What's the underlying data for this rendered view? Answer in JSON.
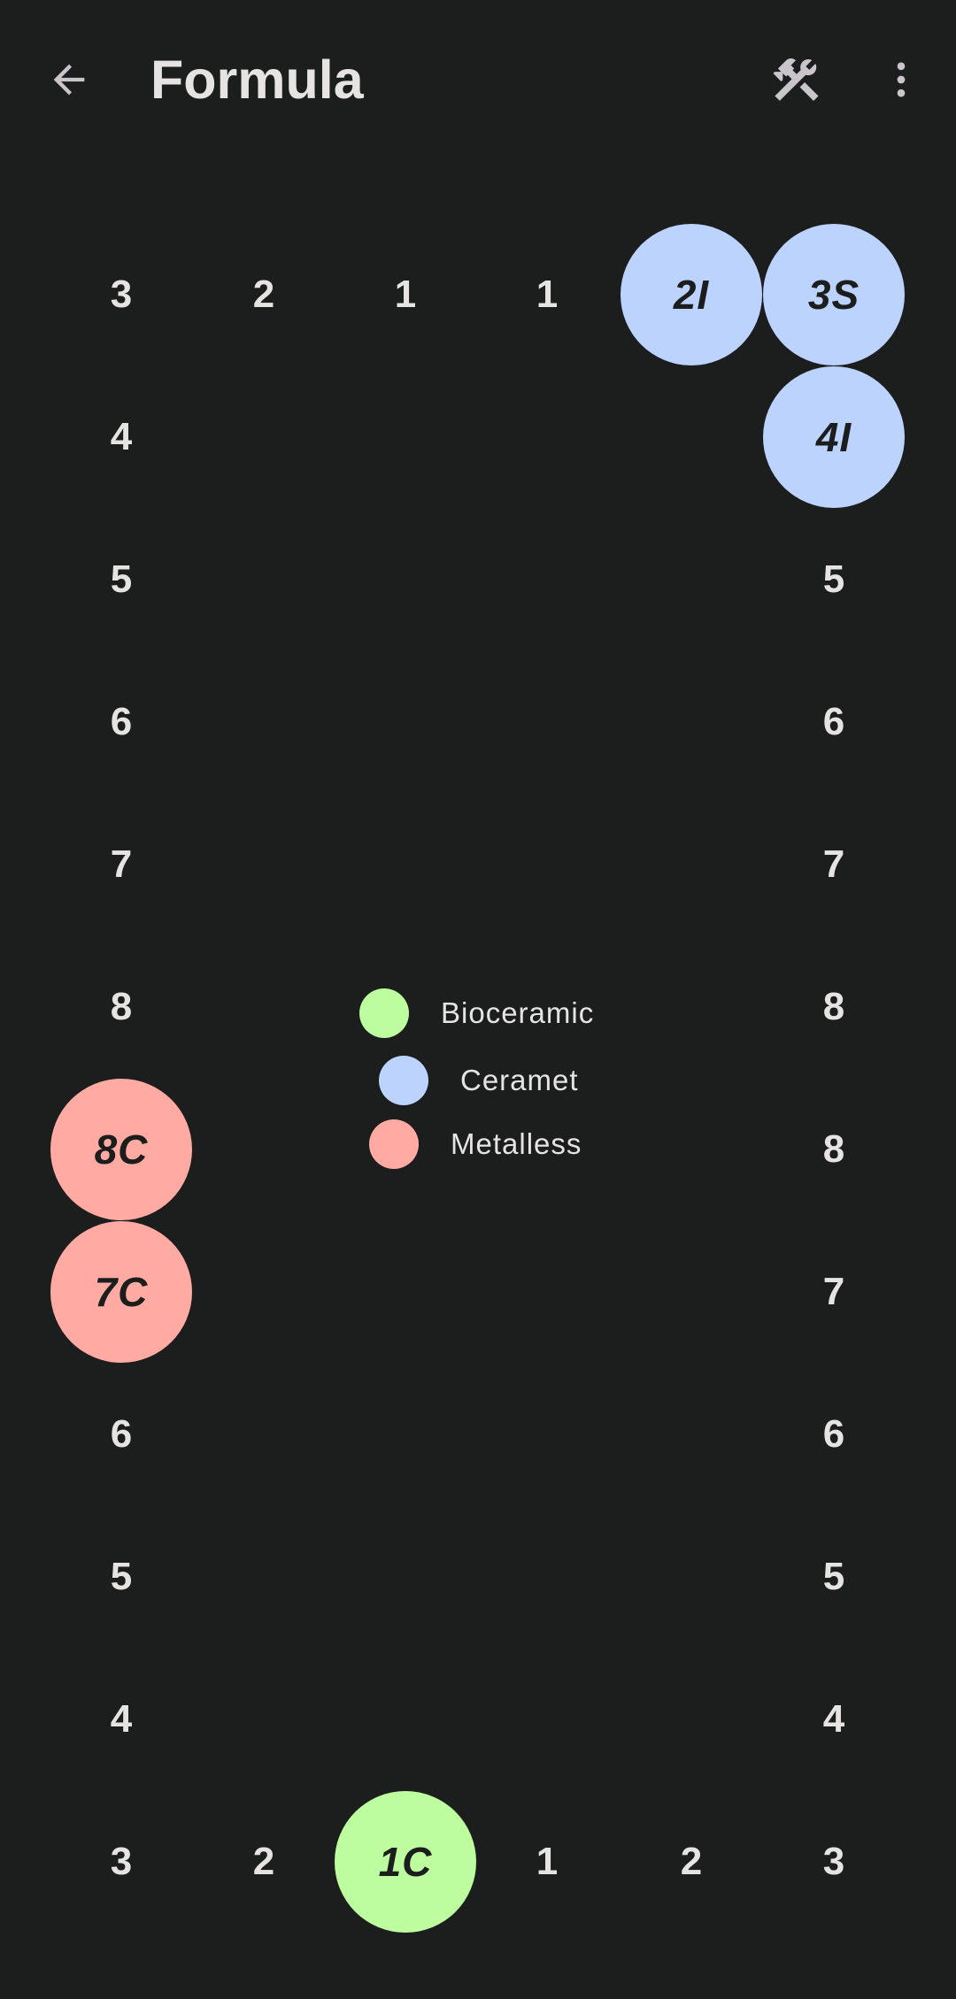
{
  "header": {
    "title": "Formula",
    "back_icon": "arrow-left-icon",
    "tools_icon": "hammer-wrench-icon",
    "menu_icon": "more-vertical-icon"
  },
  "colors": {
    "bioceramic": "#bdfd9f",
    "cermet": "#bcd3fe",
    "metalless": "#ffaaa3",
    "background": "#1c1d1d"
  },
  "legend": [
    {
      "label": "Bioceramic",
      "color": "#bdfd9f"
    },
    {
      "label": "Ceramet",
      "color": "#bcd3fe"
    },
    {
      "label": "Metalless",
      "color": "#ffaaa3"
    }
  ],
  "chart": {
    "top_row": [
      "3",
      "2",
      "1",
      "1",
      "2I",
      "3S"
    ],
    "right_col": [
      "4I",
      "5",
      "6",
      "7",
      "8",
      "8",
      "7",
      "6",
      "5",
      "4"
    ],
    "left_col": [
      "4",
      "5",
      "6",
      "7",
      "8",
      "8C",
      "7C",
      "6",
      "5",
      "4"
    ],
    "bottom_row": [
      "3",
      "2",
      "1C",
      "1",
      "2",
      "3"
    ]
  }
}
